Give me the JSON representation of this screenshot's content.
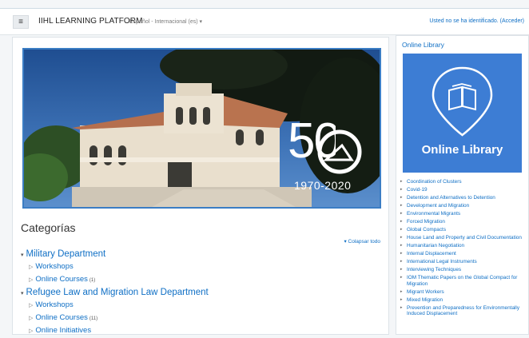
{
  "header": {
    "brand": "IIHL LEARNING PLATFORM",
    "language": "Español - Internacional (es) ▾",
    "login_prefix": "Usted no se ha identificado.",
    "login_link": "(Acceder)"
  },
  "banner": {
    "big_number": "50",
    "years": "1970-2020"
  },
  "categories": {
    "title": "Categorías",
    "collapse_all": "Colapsar todo",
    "departments": [
      {
        "name": "Military Department",
        "children": [
          {
            "name": "Workshops",
            "count": ""
          },
          {
            "name": "Online Courses",
            "count": "(1)"
          }
        ]
      },
      {
        "name": "Refugee Law and Migration Law Department",
        "children": [
          {
            "name": "Workshops",
            "count": ""
          },
          {
            "name": "Online Courses",
            "count": "(11)"
          },
          {
            "name": "Online Initiatives",
            "count": ""
          }
        ]
      }
    ]
  },
  "sidebar": {
    "title": "Online Library",
    "card_label": "Online Library",
    "links": [
      "Coordination of Clusters",
      "Covid-19",
      "Detention and Alternatives to Detention",
      "Development and Migration",
      "Environmental Migrants",
      "Forced Migration",
      "Global Compacts",
      "House Land and Property and Civil Documentation",
      "Humanitarian Negotiation",
      "Internal Displacement",
      "International Legal Instruments",
      "Interviewing Techniques",
      "IOM Thematic Papers on the Global Compact for Migration",
      "Migrant Workers",
      "Mixed Migration",
      "Prevention and Preparedness for Environmentally Induced Displacement"
    ]
  },
  "colors": {
    "link_blue": "#0f6fc5",
    "library_card": "#3d7dd4",
    "banner_border": "#3b7dc4"
  }
}
